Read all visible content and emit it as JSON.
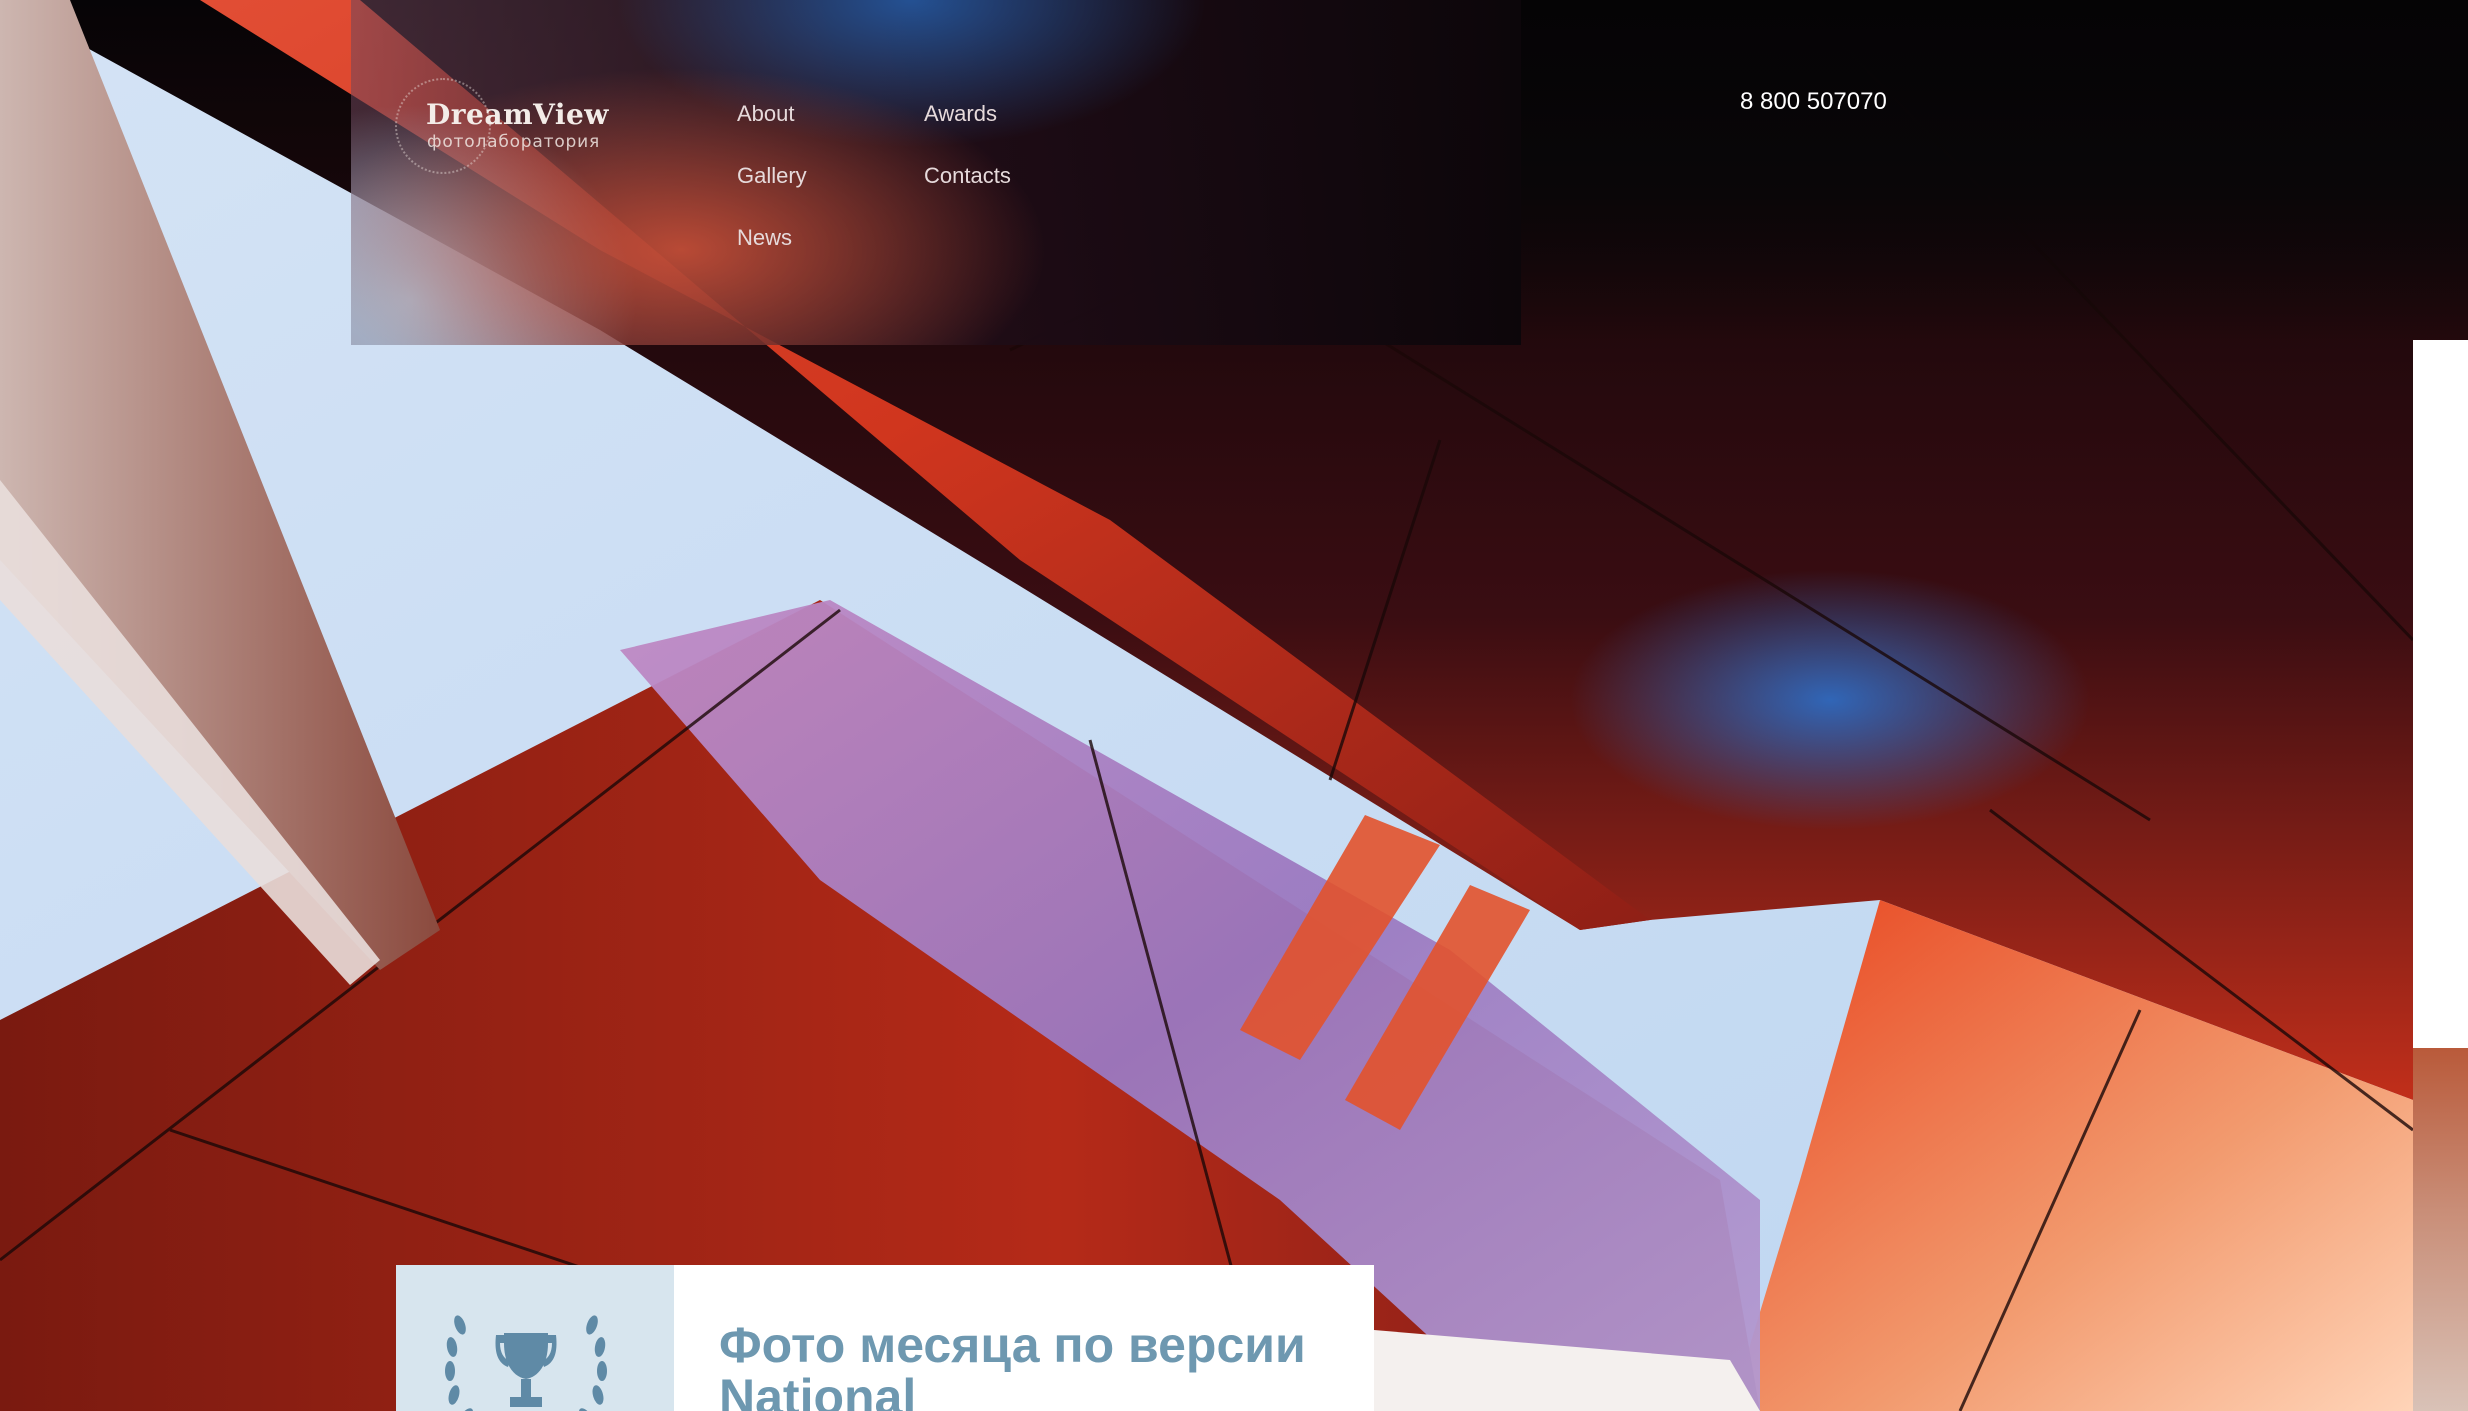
{
  "brand": {
    "name": "DreamView",
    "subtitle": "фотолаборатория"
  },
  "nav": {
    "items": [
      {
        "label": "About"
      },
      {
        "label": "Awards"
      },
      {
        "label": "Gallery"
      },
      {
        "label": "Contacts"
      },
      {
        "label": "News"
      }
    ]
  },
  "contact": {
    "phone": "8 800 507070"
  },
  "award": {
    "icon": "trophy-laurel-icon",
    "title": "Фото месяца по версии National"
  },
  "colors": {
    "accent_blue": "#6e98b0",
    "hero_red": "#c9321f",
    "sky": "#c9dcf2"
  }
}
